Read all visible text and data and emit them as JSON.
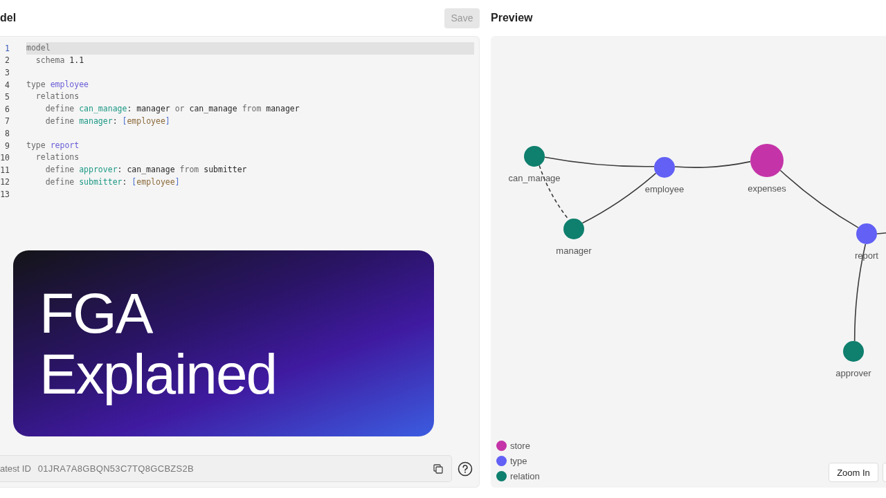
{
  "editor": {
    "title": "del",
    "save_button": {
      "label": "Save",
      "disabled": true
    },
    "lines": [
      {
        "number": "1",
        "active": true,
        "tokens": [
          {
            "text": "model",
            "kind": "keyword"
          }
        ]
      },
      {
        "number": "2",
        "active": false,
        "tokens": [
          {
            "text": "  schema ",
            "kind": "keyword"
          },
          {
            "text": "1.1",
            "kind": "plain"
          }
        ]
      },
      {
        "number": "3",
        "active": false
      },
      {
        "number": "4",
        "active": false,
        "tokens": [
          {
            "text": "type ",
            "kind": "keyword"
          },
          {
            "text": "employee",
            "kind": "type"
          }
        ]
      },
      {
        "number": "5",
        "active": false,
        "tokens": [
          {
            "text": "  relations",
            "kind": "keyword"
          }
        ]
      },
      {
        "number": "6",
        "active": false,
        "tokens": [
          {
            "text": "    define ",
            "kind": "keyword"
          },
          {
            "text": "can_manage",
            "kind": "relation"
          },
          {
            "text": ": manager ",
            "kind": "plain"
          },
          {
            "text": "or ",
            "kind": "keyword"
          },
          {
            "text": "can_manage ",
            "kind": "plain"
          },
          {
            "text": "from ",
            "kind": "keyword"
          },
          {
            "text": "manager",
            "kind": "plain"
          }
        ]
      },
      {
        "number": "7",
        "active": false,
        "tokens": [
          {
            "text": "    define ",
            "kind": "keyword"
          },
          {
            "text": "manager",
            "kind": "relation"
          },
          {
            "text": ": ",
            "kind": "plain"
          },
          {
            "text": "[",
            "kind": "bracket"
          },
          {
            "text": "employee",
            "kind": "ref"
          },
          {
            "text": "]",
            "kind": "bracket"
          }
        ]
      },
      {
        "number": "8",
        "active": false
      },
      {
        "number": "9",
        "active": false,
        "tokens": [
          {
            "text": "type ",
            "kind": "keyword"
          },
          {
            "text": "report",
            "kind": "type"
          }
        ]
      },
      {
        "number": "10",
        "active": false,
        "tokens": [
          {
            "text": "  relations",
            "kind": "keyword"
          }
        ]
      },
      {
        "number": "11",
        "active": false,
        "tokens": [
          {
            "text": "    define ",
            "kind": "keyword"
          },
          {
            "text": "approver",
            "kind": "relation"
          },
          {
            "text": ": can_manage ",
            "kind": "plain"
          },
          {
            "text": "from ",
            "kind": "keyword"
          },
          {
            "text": "submitter",
            "kind": "plain"
          }
        ]
      },
      {
        "number": "12",
        "active": false,
        "tokens": [
          {
            "text": "    define ",
            "kind": "keyword"
          },
          {
            "text": "submitter",
            "kind": "relation"
          },
          {
            "text": ": ",
            "kind": "plain"
          },
          {
            "text": "[",
            "kind": "bracket"
          },
          {
            "text": "employee",
            "kind": "ref"
          },
          {
            "text": "]",
            "kind": "bracket"
          }
        ]
      },
      {
        "number": "13",
        "active": false
      }
    ],
    "id_field": {
      "label": "atest ID",
      "value": "01JRA7A8GBQN53C7TQ8GCBZS2B"
    }
  },
  "overlay": {
    "lines": [
      "FGA",
      "Explained"
    ]
  },
  "preview": {
    "title": "Preview",
    "nodes": [
      {
        "label": "can_manage",
        "kind": "relation"
      },
      {
        "label": "employee",
        "kind": "type"
      },
      {
        "label": "expenses",
        "kind": "store"
      },
      {
        "label": "manager",
        "kind": "relation"
      },
      {
        "label": "report",
        "kind": "type"
      },
      {
        "label": "approver",
        "kind": "relation"
      }
    ],
    "edges": [
      {
        "dashed": false
      },
      {
        "dashed": true
      },
      {
        "dashed": false
      },
      {
        "dashed": false
      },
      {
        "dashed": false
      },
      {
        "dashed": false
      }
    ],
    "legend": [
      {
        "label": "store",
        "kind": "store",
        "color": "#c434a8"
      },
      {
        "label": "type",
        "kind": "type",
        "color": "#6260f5"
      },
      {
        "label": "relation",
        "kind": "relation",
        "color": "#0f7f6e"
      }
    ],
    "zoom_button": {
      "label": "Zoom In"
    }
  }
}
